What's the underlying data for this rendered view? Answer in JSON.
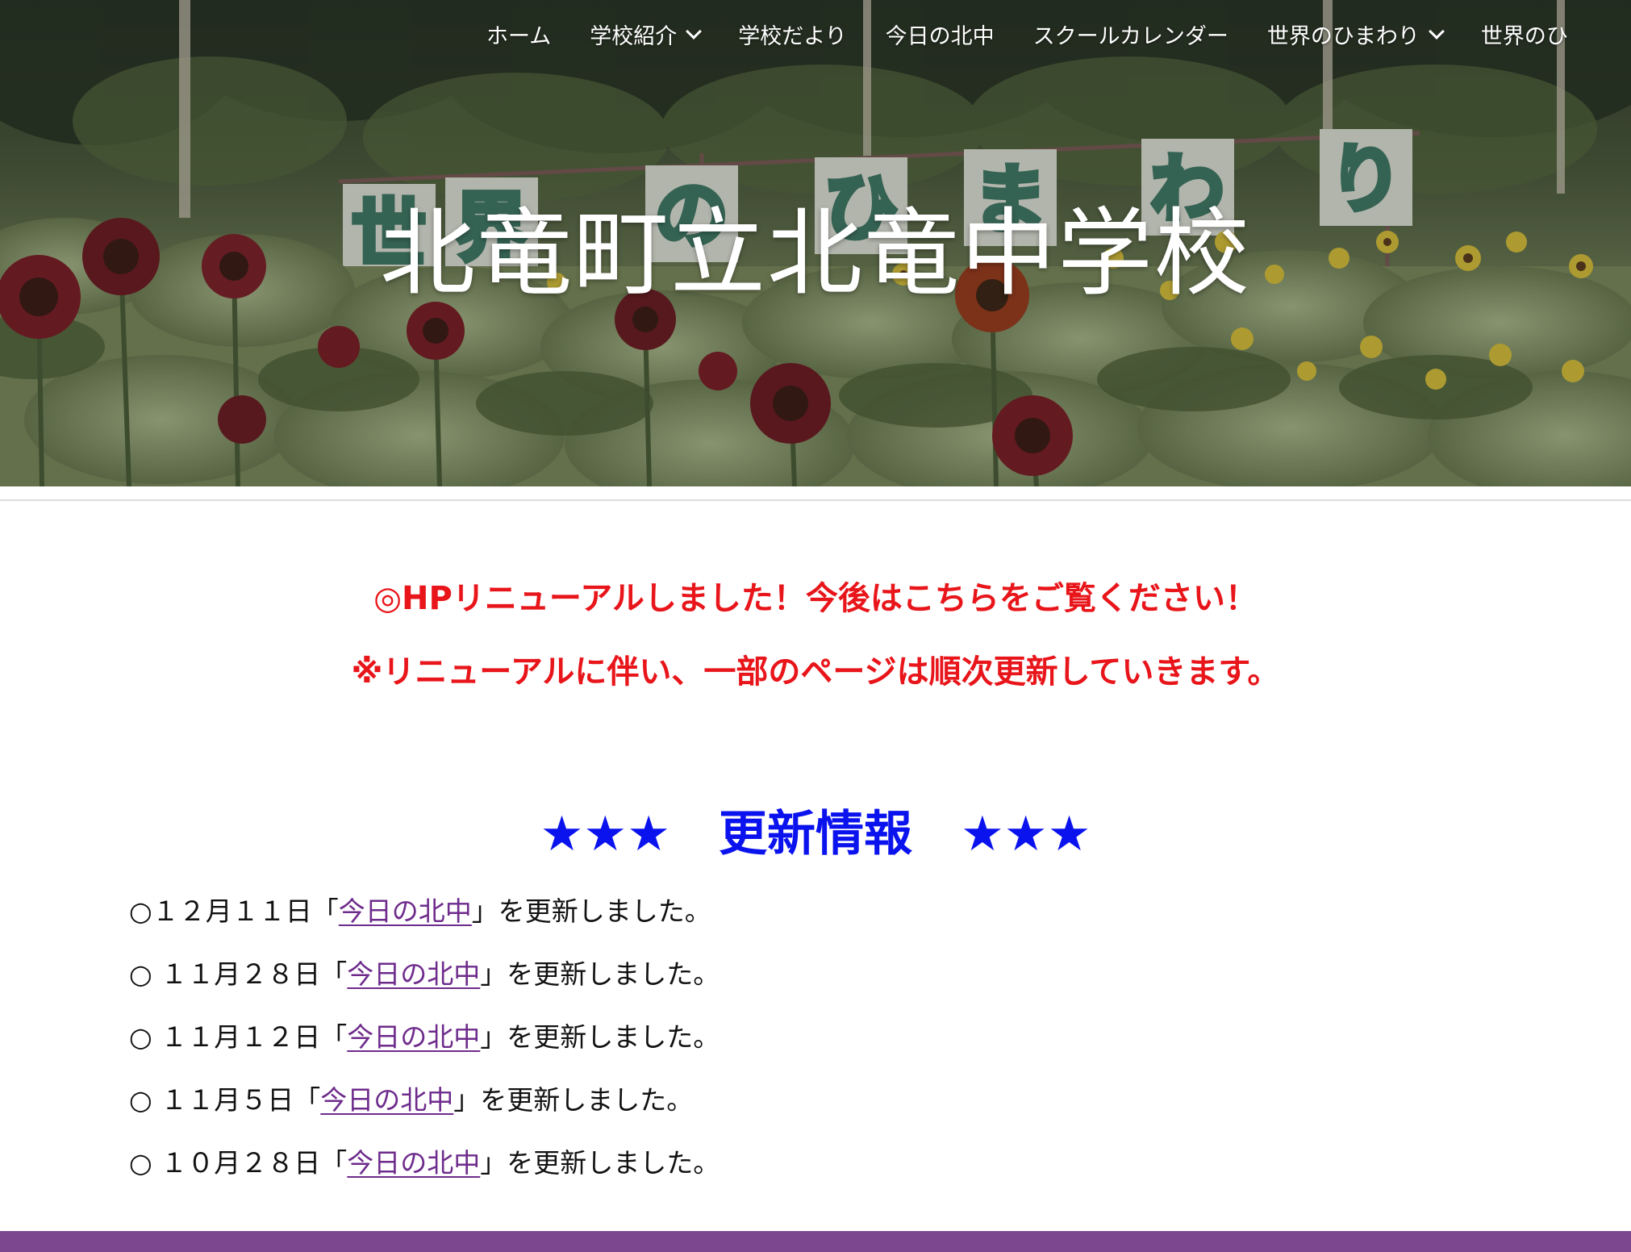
{
  "nav": {
    "items": [
      {
        "label": "ホーム",
        "has_dropdown": false
      },
      {
        "label": "学校紹介",
        "has_dropdown": true
      },
      {
        "label": "学校だより",
        "has_dropdown": false
      },
      {
        "label": "今日の北中",
        "has_dropdown": false
      },
      {
        "label": "スクールカレンダー",
        "has_dropdown": false
      },
      {
        "label": "世界のひまわり",
        "has_dropdown": true
      },
      {
        "label": "世界のひ",
        "has_dropdown": false
      }
    ]
  },
  "hero": {
    "site_title": "北竜町立北竜中学校",
    "sign_letters": [
      "世",
      "界",
      "の",
      "ひ",
      "ま",
      "わ",
      "り"
    ]
  },
  "notices": {
    "line1": "◎HPリニューアルしました！今後はこちらをご覧ください！",
    "line2": "※リニューアルに伴い、一部のページは順次更新していきます。",
    "color": "#e8151a"
  },
  "updates": {
    "heading": "★★★　更新情報　★★★",
    "heading_color": "#0a12ee",
    "link_color": "#6e2b8c",
    "items": [
      {
        "prefix": "○１２月１１日「",
        "link": "今日の北中",
        "suffix": "」を更新しました。"
      },
      {
        "prefix": "○ １１月２８日「",
        "link": "今日の北中",
        "suffix": "」を更新しました。"
      },
      {
        "prefix": "○ １１月１２日「",
        "link": "今日の北中",
        "suffix": "」を更新しました。"
      },
      {
        "prefix": "○ １１月５日「",
        "link": "今日の北中",
        "suffix": "」を更新しました。"
      },
      {
        "prefix": "○ １０月２８日「",
        "link": "今日の北中",
        "suffix": "」を更新しました。"
      }
    ]
  },
  "footer": {
    "bar_color": "#7d4790"
  }
}
